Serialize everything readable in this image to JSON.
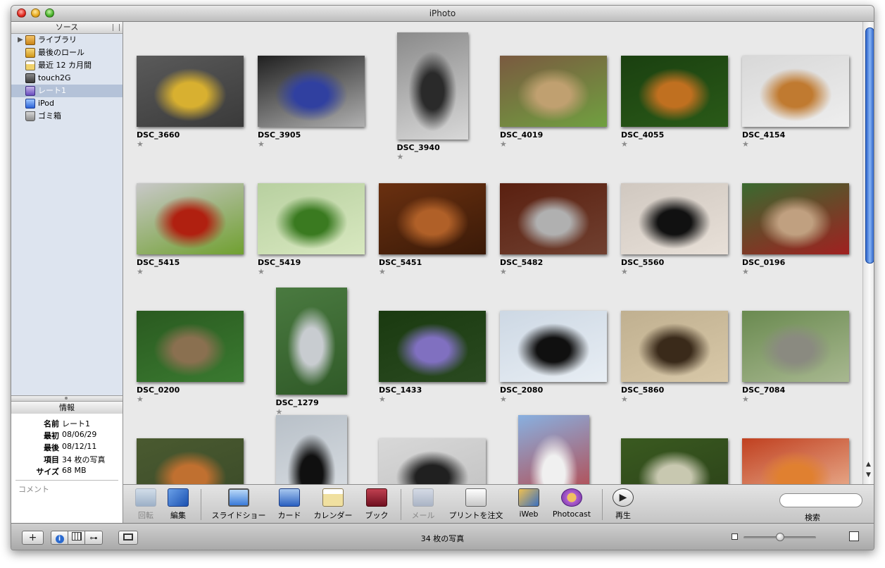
{
  "window": {
    "title": "iPhoto"
  },
  "sidebar": {
    "header": "ソース",
    "items": [
      {
        "label": "ライブラリ",
        "icon": "library-icon"
      },
      {
        "label": "最後のロール",
        "icon": "film-roll-icon"
      },
      {
        "label": "最近 12 カ月間",
        "icon": "calendar-icon"
      },
      {
        "label": "touch2G",
        "icon": "device-icon"
      },
      {
        "label": "レート1",
        "icon": "smart-album-icon",
        "selected": true
      },
      {
        "label": "iPod",
        "icon": "ipod-icon"
      },
      {
        "label": "ゴミ箱",
        "icon": "trash-icon"
      }
    ]
  },
  "info": {
    "header": "情報",
    "name_key": "名前",
    "name_val": "レート1",
    "first_key": "最初",
    "first_val": "08/06/29",
    "last_key": "最後",
    "last_val": "08/12/11",
    "items_key": "項目",
    "items_val": "34 枚の写真",
    "size_key": "サイズ",
    "size_val": "68 MB",
    "comment_label": "コメント"
  },
  "photos": [
    {
      "title": "DSC_3660",
      "rating": "★",
      "colors": [
        "#5a5a5a",
        "#d8b030",
        "#3a3a3a"
      ]
    },
    {
      "title": "DSC_3905",
      "rating": "★",
      "colors": [
        "#202020",
        "#3040a0",
        "#b0b0b0"
      ]
    },
    {
      "title": "DSC_3940",
      "rating": "★",
      "colors": [
        "#8a8a8a",
        "#2a2a2a",
        "#d8d8d8"
      ]
    },
    {
      "title": "DSC_4019",
      "rating": "★",
      "colors": [
        "#7a5a40",
        "#c0a070",
        "#70a040"
      ]
    },
    {
      "title": "DSC_4055",
      "rating": "★",
      "colors": [
        "#1a4010",
        "#c07020",
        "#2a5a18"
      ]
    },
    {
      "title": "DSC_4154",
      "rating": "★",
      "colors": [
        "#d8d8d8",
        "#c07a30",
        "#eeeeee"
      ]
    },
    {
      "title": "DSC_5415",
      "rating": "★",
      "colors": [
        "#c8c8c8",
        "#b02010",
        "#70a030"
      ]
    },
    {
      "title": "DSC_5419",
      "rating": "★",
      "colors": [
        "#b8d0a0",
        "#3a7a20",
        "#d8e8c0"
      ]
    },
    {
      "title": "DSC_5451",
      "rating": "★",
      "colors": [
        "#6a3010",
        "#b06028",
        "#3a1a08"
      ]
    },
    {
      "title": "DSC_5482",
      "rating": "★",
      "colors": [
        "#5a2010",
        "#b0b0b0",
        "#704030"
      ]
    },
    {
      "title": "DSC_5560",
      "rating": "★",
      "colors": [
        "#d0c8c0",
        "#111111",
        "#e8e0d8"
      ]
    },
    {
      "title": "DSC_0196",
      "rating": "★",
      "colors": [
        "#3a6a30",
        "#c0a080",
        "#a02020"
      ]
    },
    {
      "title": "DSC_0200",
      "rating": "★",
      "colors": [
        "#2a5a20",
        "#8a7050",
        "#3a7a30"
      ]
    },
    {
      "title": "DSC_1279",
      "rating": "★",
      "colors": [
        "#4a7a40",
        "#c8ccd0",
        "#305a28"
      ]
    },
    {
      "title": "DSC_1433",
      "rating": "★",
      "colors": [
        "#1a3a10",
        "#8070c0",
        "#2a4a20"
      ]
    },
    {
      "title": "DSC_2080",
      "rating": "★",
      "colors": [
        "#cdd8e4",
        "#101010",
        "#e8eef4"
      ]
    },
    {
      "title": "DSC_5860",
      "rating": "★",
      "colors": [
        "#c0b090",
        "#3a2a1a",
        "#d8c8a8"
      ]
    },
    {
      "title": "DSC_7084",
      "rating": "★",
      "colors": [
        "#6a8a50",
        "#8a8a80",
        "#a8b890"
      ]
    },
    {
      "title": "",
      "rating": "",
      "colors": [
        "#4a5a30",
        "#c07030",
        "#3a4a28"
      ]
    },
    {
      "title": "",
      "rating": "",
      "colors": [
        "#b8c0c8",
        "#101010",
        "#e0e4e8"
      ]
    },
    {
      "title": "",
      "rating": "",
      "colors": [
        "#d8d8d8",
        "#202020",
        "#c0c0c0"
      ]
    },
    {
      "title": "",
      "rating": "",
      "colors": [
        "#88b0e0",
        "#f0f0f0",
        "#c0302a"
      ]
    },
    {
      "title": "",
      "rating": "",
      "colors": [
        "#3a5a20",
        "#c8c8b0",
        "#2a4018"
      ]
    },
    {
      "title": "",
      "rating": "",
      "colors": [
        "#c04020",
        "#e08030",
        "#f0c0a0"
      ]
    }
  ],
  "toolbar": {
    "rotate": "回転",
    "edit": "編集",
    "slideshow": "スライドショー",
    "card": "カード",
    "calendar": "カレンダー",
    "book": "ブック",
    "mail": "メール",
    "order_prints": "プリントを注文",
    "iweb": "iWeb",
    "photocast": "Photocast",
    "play": "再生",
    "search_label": "検索",
    "search_value": ""
  },
  "statusbar": {
    "add": "+",
    "photo_count": "34 枚の写真",
    "zoom_fraction": 0.5
  }
}
